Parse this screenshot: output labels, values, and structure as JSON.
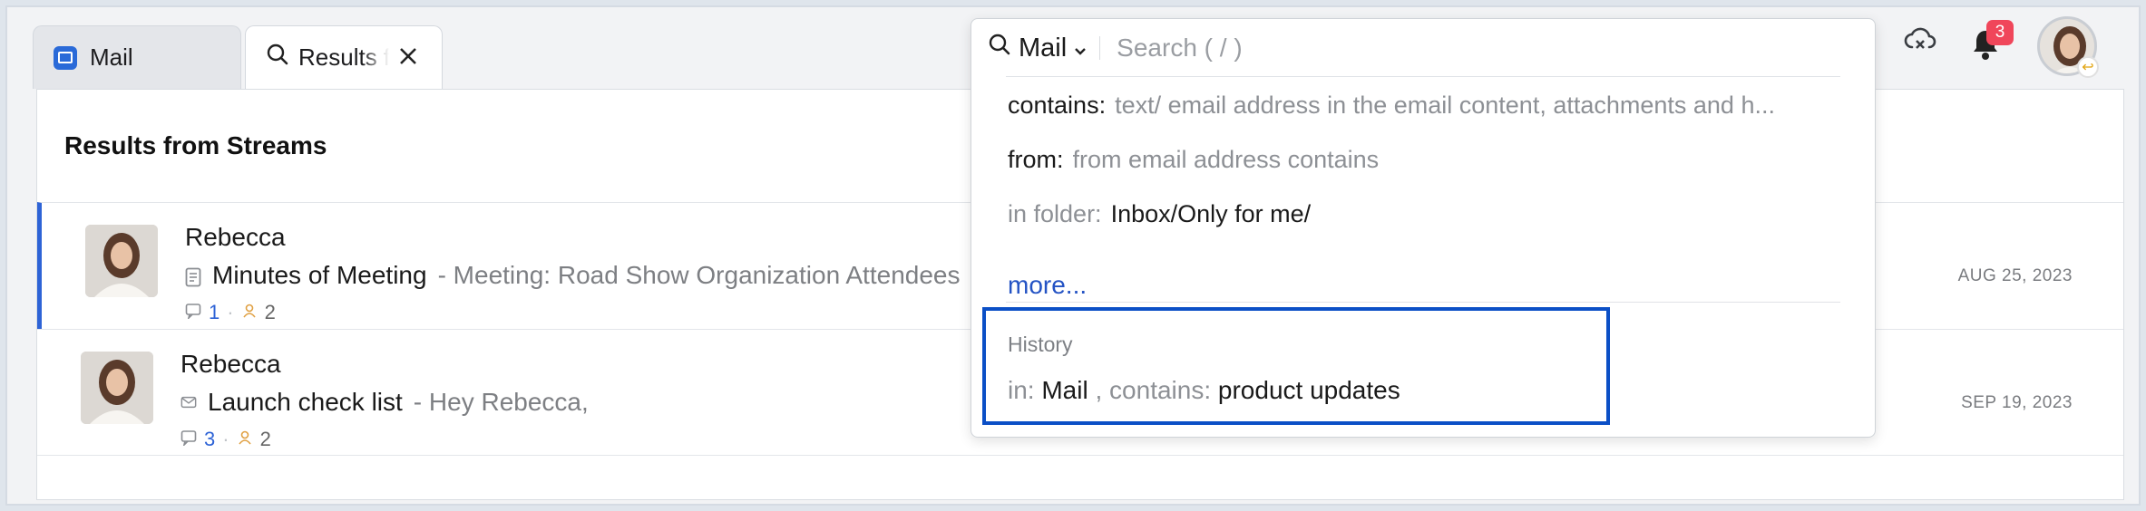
{
  "tabs": [
    {
      "label": "Mail"
    },
    {
      "label": "Results from Streams"
    }
  ],
  "page": {
    "title": "Results from Streams"
  },
  "rows": [
    {
      "sender": "Rebecca",
      "subject": "Minutes of Meeting",
      "snippet": "- Meeting: Road Show Organization Attendees",
      "comments": "1",
      "participants": "2",
      "date": "AUG 25, 2023"
    },
    {
      "sender": "Rebecca",
      "subject": "Launch check list",
      "snippet": "- Hey Rebecca,",
      "comments": "3",
      "participants": "2",
      "date": "SEP 19, 2023"
    }
  ],
  "header": {
    "notification_count": "3"
  },
  "search": {
    "scope": "Mail",
    "placeholder": "Search ( / )",
    "suggestions": [
      {
        "key": "contains:",
        "value": "text/ email address in the email content, attachments and h..."
      },
      {
        "key": "from:",
        "value": "from email address contains"
      },
      {
        "key": "in folder:",
        "value": "Inbox/Only for me/"
      }
    ],
    "more": "more...",
    "history": {
      "heading": "History",
      "in_label": "in:",
      "in_value": "Mail",
      "contains_label": ", contains:",
      "contains_value": "product updates"
    }
  },
  "colors": {
    "accent": "#2e63d6",
    "highlight_border": "#0b4fc6",
    "badge": "#f0465a"
  }
}
